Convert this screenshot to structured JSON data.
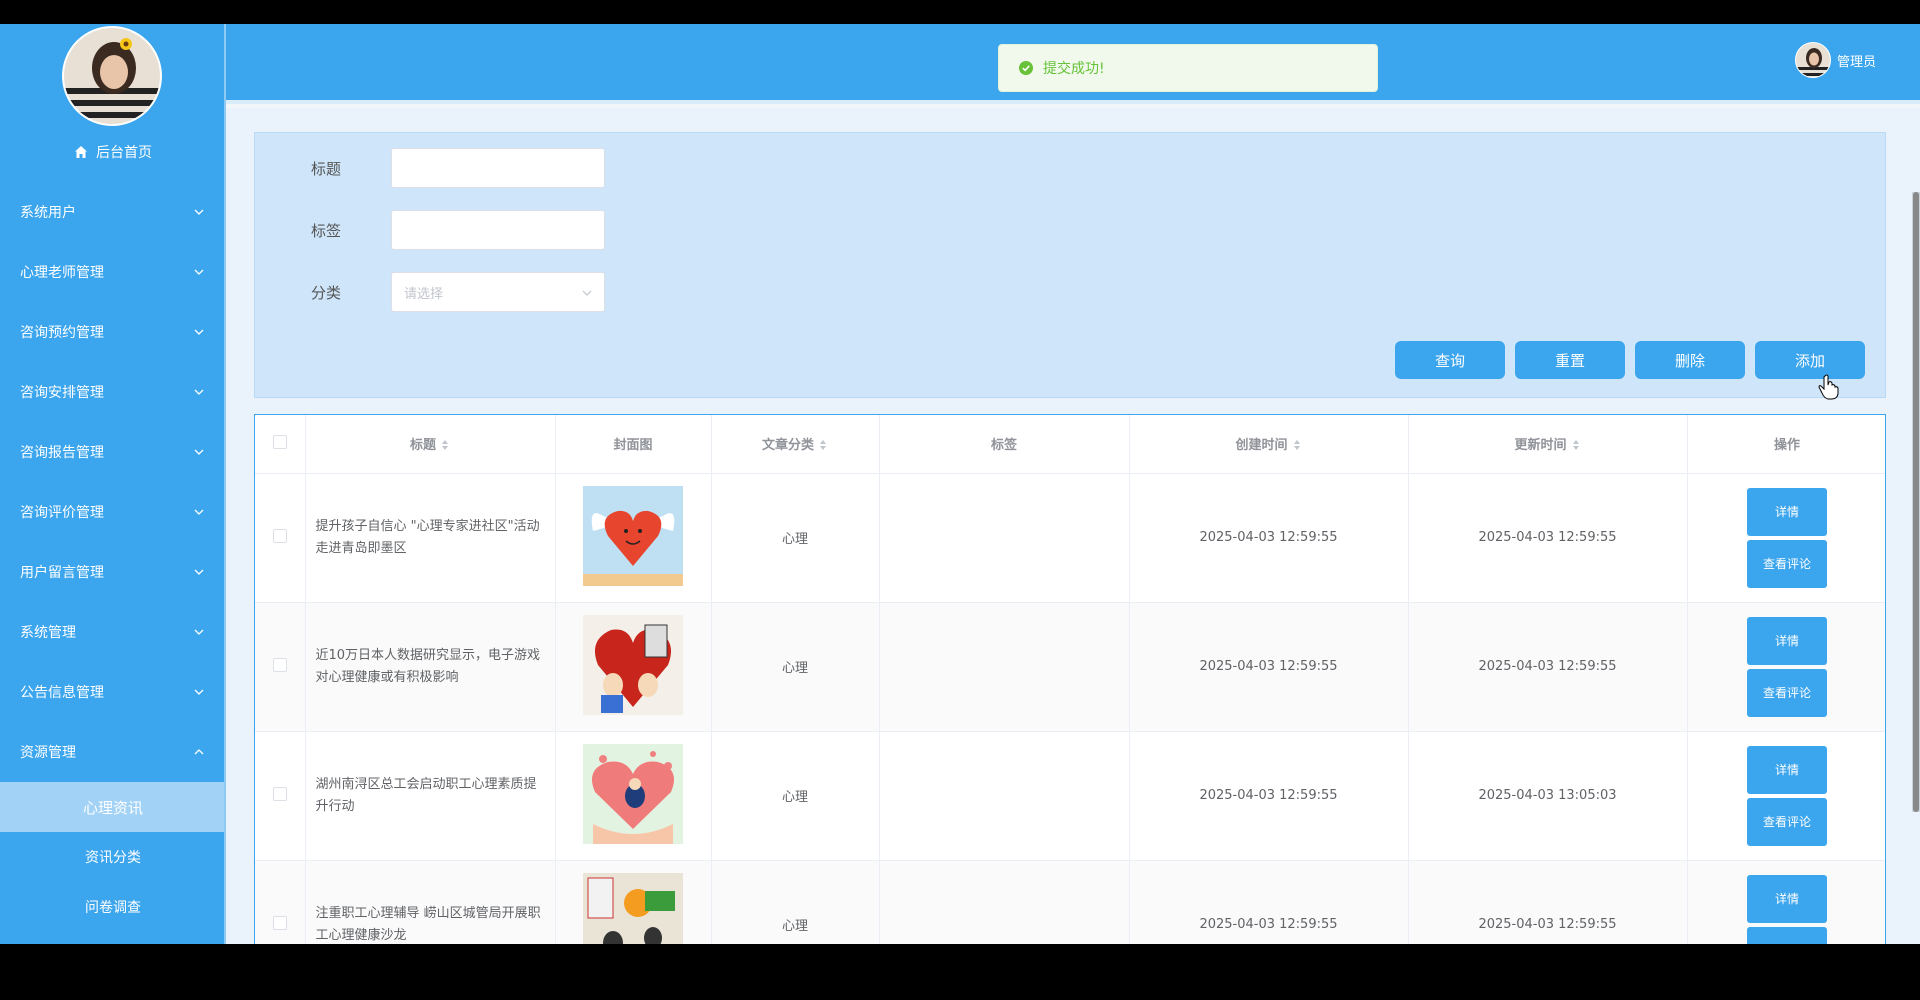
{
  "toast": {
    "message": "提交成功!"
  },
  "user": {
    "name": "管理员"
  },
  "sidebar": {
    "home": "后台首页",
    "items": [
      {
        "label": "系统用户"
      },
      {
        "label": "心理老师管理"
      },
      {
        "label": "咨询预约管理"
      },
      {
        "label": "咨询安排管理"
      },
      {
        "label": "咨询报告管理"
      },
      {
        "label": "咨询评价管理"
      },
      {
        "label": "用户留言管理"
      },
      {
        "label": "系统管理"
      },
      {
        "label": "公告信息管理"
      },
      {
        "label": "资源管理"
      }
    ],
    "subitems": [
      {
        "label": "心理资讯"
      },
      {
        "label": "资讯分类"
      },
      {
        "label": "问卷调查"
      }
    ]
  },
  "search": {
    "title_label": "标题",
    "tag_label": "标签",
    "category_label": "分类",
    "category_placeholder": "请选择",
    "btn_query": "查询",
    "btn_reset": "重置",
    "btn_delete": "删除",
    "btn_add": "添加"
  },
  "table": {
    "headers": {
      "title": "标题",
      "cover": "封面图",
      "category": "文章分类",
      "tag": "标签",
      "created": "创建时间",
      "updated": "更新时间",
      "ops": "操作"
    },
    "detail_label": "详情",
    "comments_label": "查看评论",
    "rows": [
      {
        "title": "提升孩子自信心 \"心理专家进社区\"活动走进青岛即墨区",
        "category": "心理",
        "tag": "",
        "created": "2025-04-03 12:59:55",
        "updated": "2025-04-03 12:59:55"
      },
      {
        "title": "近10万日本人数据研究显示，电子游戏对心理健康或有积极影响",
        "category": "心理",
        "tag": "",
        "created": "2025-04-03 12:59:55",
        "updated": "2025-04-03 12:59:55"
      },
      {
        "title": "湖州南浔区总工会启动职工心理素质提升行动",
        "category": "心理",
        "tag": "",
        "created": "2025-04-03 12:59:55",
        "updated": "2025-04-03 13:05:03"
      },
      {
        "title": "注重职工心理辅导 崂山区城管局开展职工心理健康沙龙",
        "category": "心理",
        "tag": "",
        "created": "2025-04-03 12:59:55",
        "updated": "2025-04-03 12:59:55"
      }
    ]
  },
  "colors": {
    "primary": "#3ba5ee",
    "success": "#67c23a"
  }
}
